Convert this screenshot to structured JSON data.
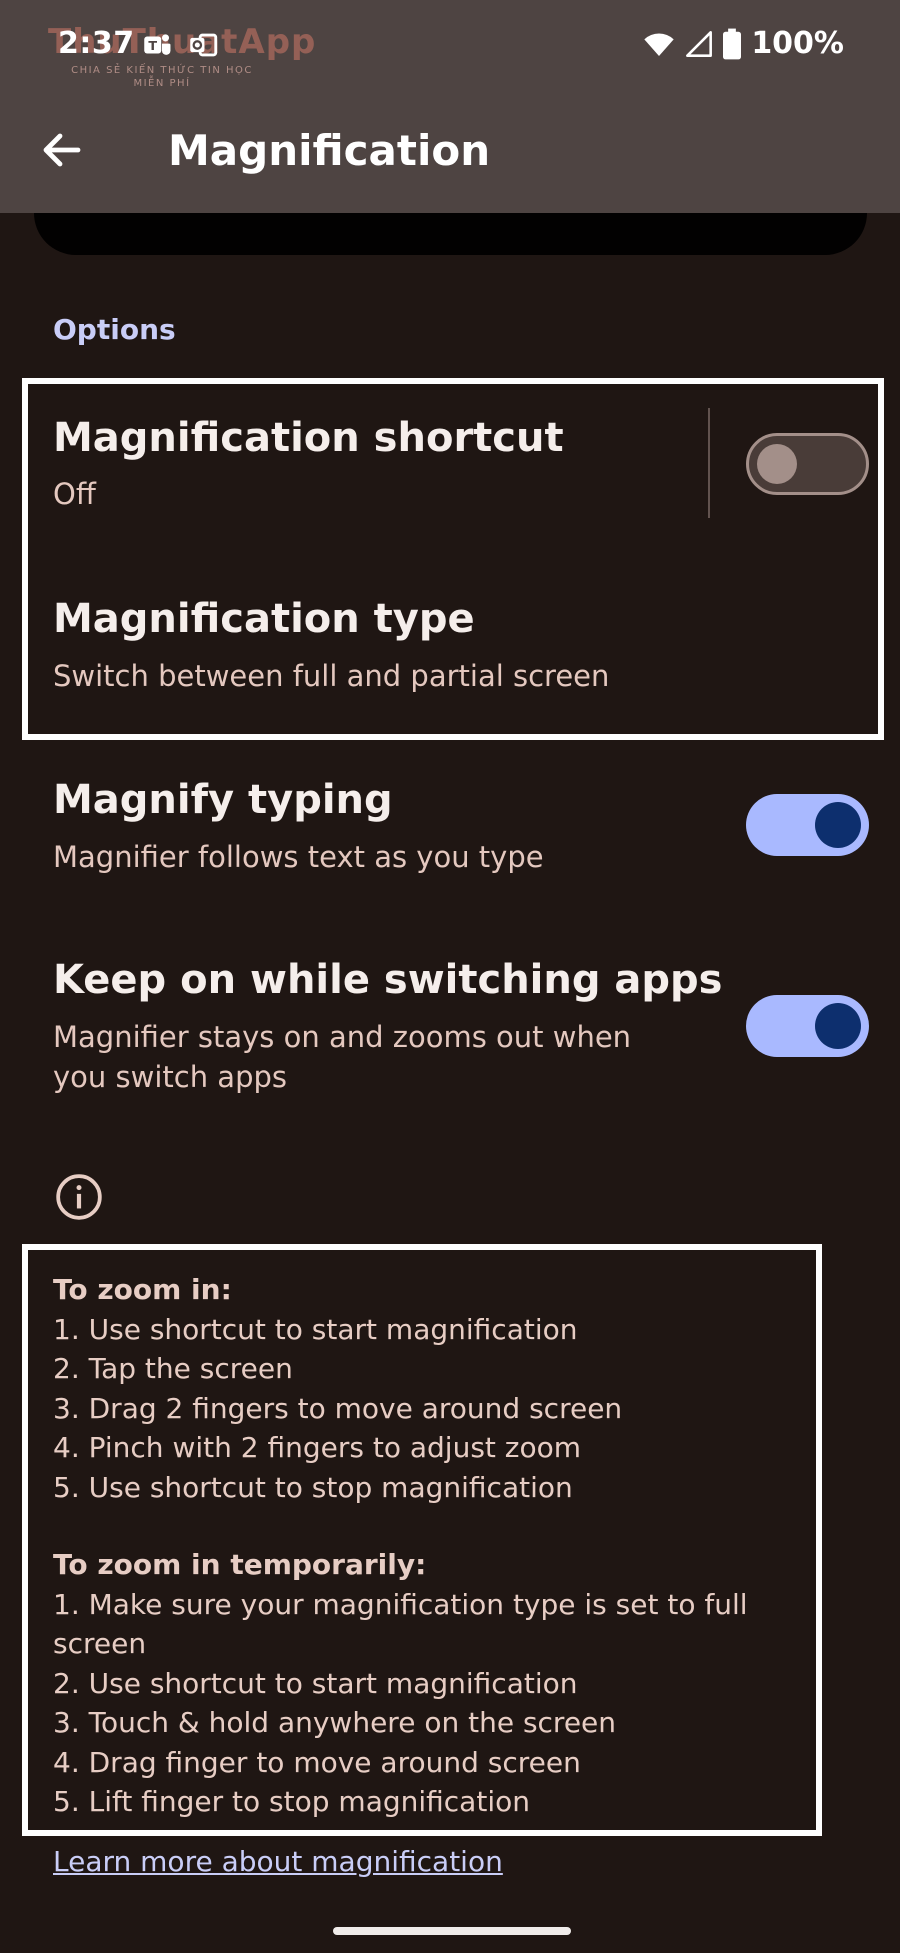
{
  "status_bar": {
    "time": "2:37",
    "battery": "100%",
    "watermark": "ThuThuatApp",
    "watermark_sub": "CHIA SẺ KIẾN THỨC TIN HỌC MIỄN PHÍ",
    "icons": [
      "teams-icon",
      "outlook-icon",
      "wifi-icon",
      "signal-icon",
      "battery-icon"
    ]
  },
  "header": {
    "title": "Magnification",
    "back_icon": "arrow-back-icon"
  },
  "options": {
    "section_title": "Options",
    "shortcut": {
      "title": "Magnification shortcut",
      "subtitle": "Off",
      "enabled": false
    },
    "type": {
      "title": "Magnification type",
      "subtitle": "Switch between full and partial screen"
    },
    "magnify_typing": {
      "title": "Magnify typing",
      "subtitle": "Magnifier follows text as you type",
      "enabled": true
    },
    "keep_on": {
      "title": "Keep on while switching apps",
      "subtitle": "Magnifier stays on and zooms out when you switch apps",
      "enabled": true
    }
  },
  "help": {
    "zoom_in_heading": "To zoom in:",
    "zoom_in_steps": [
      "1. Use shortcut to start magnification",
      "2. Tap the screen",
      "3. Drag 2 fingers to move around screen",
      "4. Pinch with 2 fingers to adjust zoom",
      "5. Use shortcut to stop magnification"
    ],
    "temp_heading": "To zoom in temporarily:",
    "temp_steps": [
      "1. Make sure your magnification type is set to full screen",
      "2. Use shortcut to start magnification",
      "3. Touch & hold anywhere on the screen",
      "4. Drag finger to move around screen",
      "5. Lift finger to stop magnification"
    ],
    "learn_more": "Learn more about magnification"
  },
  "colors": {
    "background": "#1f1613",
    "app_bar": "#4e4442",
    "accent": "#c9cdf7",
    "switch_on_track": "#a9b9ff",
    "switch_on_thumb": "#0d2f6e"
  }
}
